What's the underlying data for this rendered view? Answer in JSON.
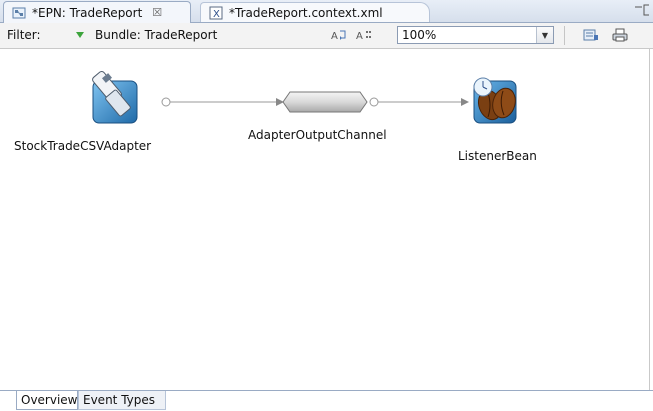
{
  "tabs": [
    {
      "label": "*EPN: TradeReport",
      "icon": "epn-diagram-icon",
      "active": true,
      "close": "☒"
    },
    {
      "label": "*TradeReport.context.xml",
      "icon": "xml-file-icon",
      "active": false
    }
  ],
  "toolbar": {
    "filter_label": "Filter:",
    "bundle_label": "Bundle: TradeReport",
    "zoom_value": "100%",
    "icons": [
      "layout-icon",
      "grid-icon",
      "export-icon",
      "print-icon"
    ]
  },
  "diagram": {
    "nodes": [
      {
        "label": "StockTradeCSVAdapter",
        "icon": "adapter-icon"
      },
      {
        "label": "AdapterOutputChannel",
        "icon": "channel-icon"
      },
      {
        "label": "ListenerBean",
        "icon": "bean-icon"
      }
    ]
  },
  "bottom_tabs": [
    "Overview",
    "Event Types"
  ],
  "colors": {
    "accent": "#9aabc4",
    "tab_bg": "#d6dfec",
    "toolbar_bg": "#f3f3f3"
  }
}
